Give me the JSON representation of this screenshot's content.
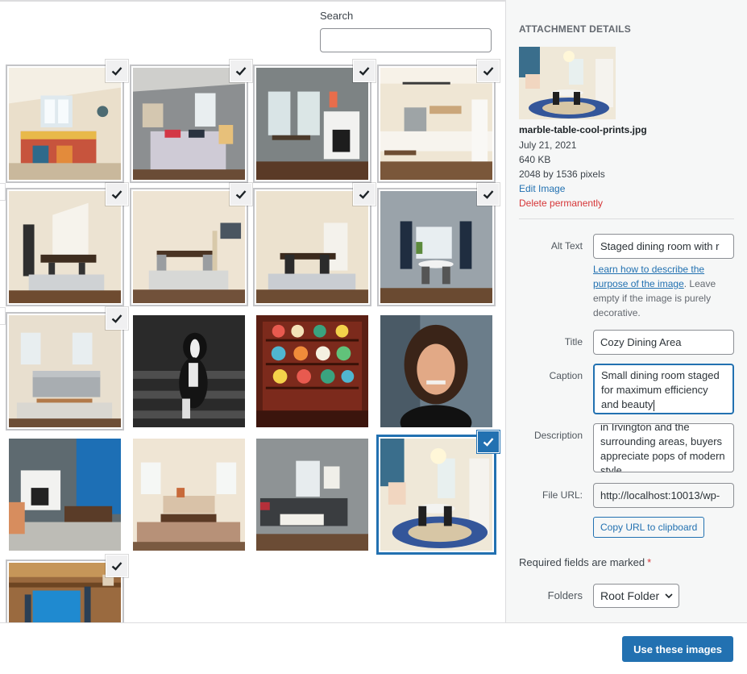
{
  "search": {
    "label": "Search",
    "value": "",
    "placeholder": ""
  },
  "grid": {
    "tiles": [
      {
        "name": "bedroom-colorful-quilt",
        "checked": true
      },
      {
        "name": "bedroom-gray-walls",
        "checked": true
      },
      {
        "name": "dining-white-fireplace",
        "checked": true
      },
      {
        "name": "kitchen-island-pendant",
        "checked": true
      },
      {
        "name": "dining-room-staircase",
        "checked": true
      },
      {
        "name": "dining-room-chandelier",
        "checked": true
      },
      {
        "name": "dining-room-archway",
        "checked": true
      },
      {
        "name": "dining-room-blue-curtains",
        "checked": true
      },
      {
        "name": "living-room-gray-sofa",
        "checked": true
      },
      {
        "name": "dog-black-and-white",
        "checked": false
      },
      {
        "name": "pyrex-collection-hutch",
        "checked": false
      },
      {
        "name": "woman-portrait",
        "checked": false
      },
      {
        "name": "living-room-blue-wall",
        "checked": false
      },
      {
        "name": "living-room-neutral",
        "checked": false
      },
      {
        "name": "living-room-dark-sofa",
        "checked": false
      },
      {
        "name": "marble-table-cool-prints",
        "checked": true,
        "selected": true
      },
      {
        "name": "wood-beams-blue-stairs",
        "checked": true
      }
    ]
  },
  "details": {
    "heading": "ATTACHMENT DETAILS",
    "filename": "marble-table-cool-prints.jpg",
    "date": "July 21, 2021",
    "filesize": "640 KB",
    "dimensions": "2048 by 1536 pixels",
    "edit_link": "Edit Image",
    "delete_link": "Delete permanently",
    "alt_text": {
      "label": "Alt Text",
      "value": "Staged dining room with r"
    },
    "alt_help": {
      "link": "Learn how to describe the purpose of the image",
      "rest": ". Leave empty if the image is purely decorative."
    },
    "title": {
      "label": "Title",
      "value": "Cozy Dining Area"
    },
    "caption": {
      "label": "Caption",
      "value": "Small dining room staged for maximum efficiency and beauty"
    },
    "description": {
      "label": "Description",
      "value": "in Irvington and the surrounding areas, buyers appreciate pops of modern style."
    },
    "file_url": {
      "label": "File URL:",
      "value": "http://localhost:10013/wp-"
    },
    "copy_button": "Copy URL to clipboard",
    "required_note": "Required fields are marked",
    "required_star": "*",
    "folders": {
      "label": "Folders",
      "selected": "Root Folder"
    }
  },
  "toolbar": {
    "primary": "Use these images"
  },
  "colors": {
    "accent": "#2271b1",
    "danger": "#d63638",
    "sidebar_bg": "#f6f7f7"
  }
}
